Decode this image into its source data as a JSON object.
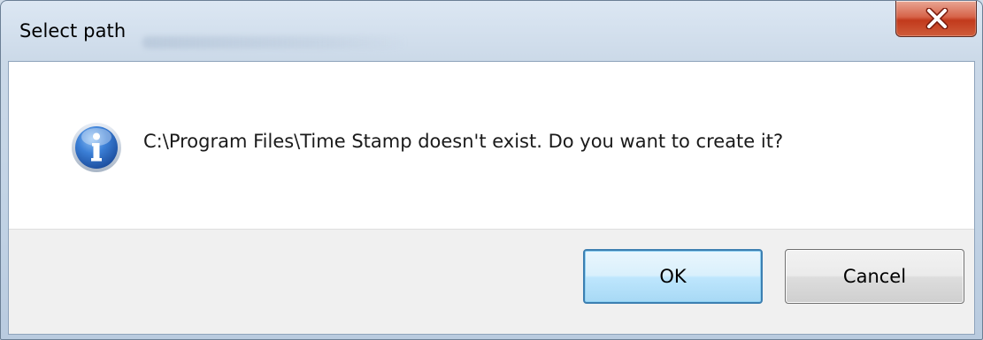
{
  "window": {
    "title": "Select path",
    "close_icon": "close-icon"
  },
  "message": {
    "icon": "info-icon",
    "text": "C:\\Program Files\\Time Stamp doesn't exist. Do you want to create it?"
  },
  "buttons": {
    "ok_label": "OK",
    "cancel_label": "Cancel"
  },
  "colors": {
    "close_button": "#c8432a",
    "ok_border": "#3c7fb1",
    "info_icon": "#2a62b3",
    "button_area": "#f0f0f0"
  }
}
